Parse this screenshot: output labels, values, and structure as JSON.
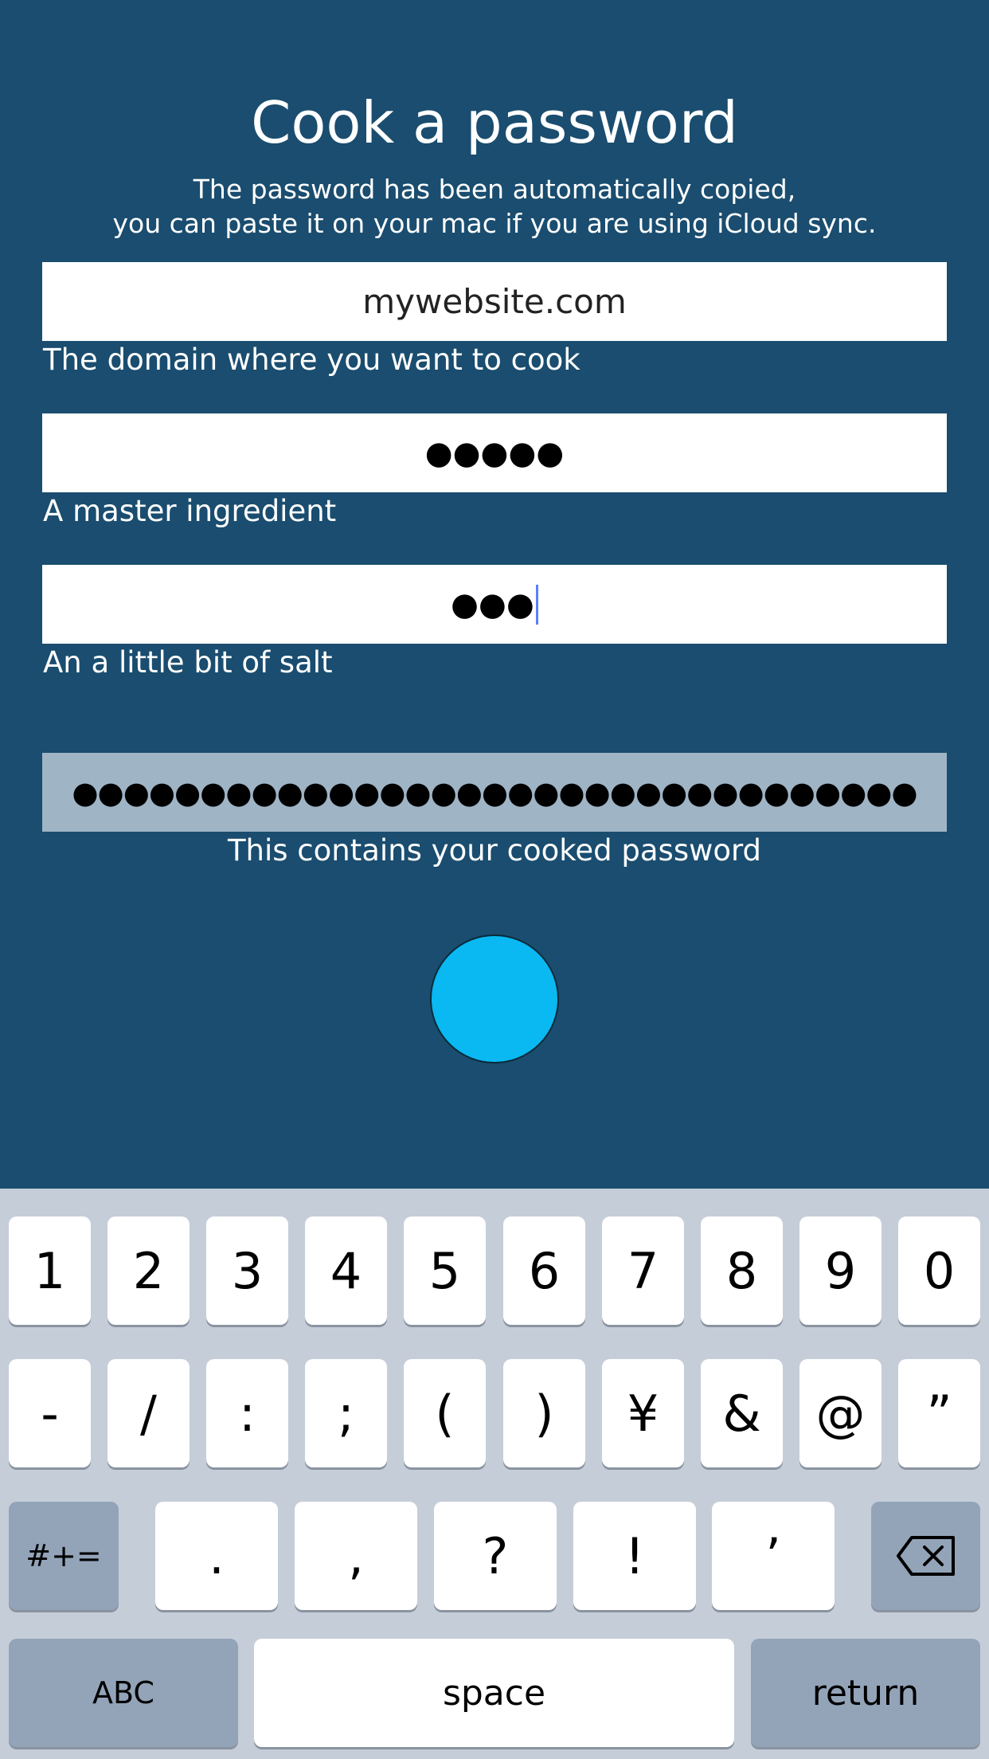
{
  "app": {
    "title": "Cook a password",
    "subtitle_line1": "The password has been automatically copied,",
    "subtitle_line2": "you can paste it on your mac if you are using iCloud sync."
  },
  "fields": {
    "domain": {
      "value": "mywebsite.com",
      "label": "The domain where you want to cook"
    },
    "master": {
      "value": "●●●●●",
      "label": "A master ingredient"
    },
    "salt": {
      "value": "●●●",
      "label": "An a little bit of salt"
    }
  },
  "result": {
    "value": "●●●●●●●●●●●●●●●●●●●●●●●●●●●●●●●●●",
    "label": "This contains your cooked password"
  },
  "cook_button": {
    "color": "#0ab8f2"
  },
  "keyboard": {
    "row1": [
      "1",
      "2",
      "3",
      "4",
      "5",
      "6",
      "7",
      "8",
      "9",
      "0"
    ],
    "row2": [
      "-",
      "/",
      ":",
      ";",
      "(",
      ")",
      "¥",
      "&",
      "@",
      "”"
    ],
    "row3": [
      ".",
      ",",
      "?",
      "!",
      "’"
    ],
    "more_symbols": "#+=",
    "abc": "ABC",
    "space": "space",
    "return": "return",
    "delete_icon": "backspace-icon"
  },
  "colors": {
    "background": "#1a4d6f",
    "result_field": "#9fb4c5",
    "keyboard": "#c5cdd9",
    "caret": "#5b7fff"
  }
}
